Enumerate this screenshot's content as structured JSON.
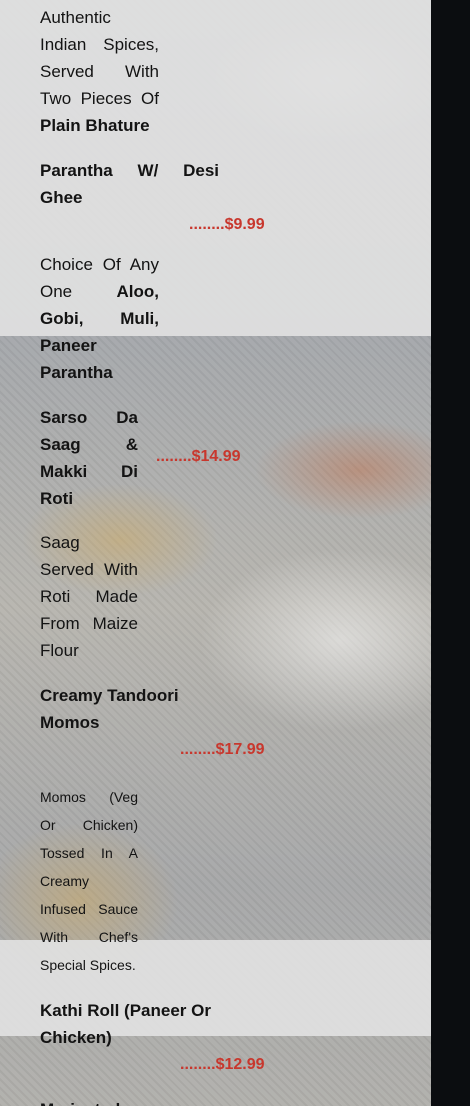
{
  "items": [
    {
      "description_prefix": "Authentic Indian Spices, Served With Two Pieces Of",
      "description_bold": "Plain Bhature"
    },
    {
      "name": "Parantha W/ Desi Ghee",
      "price": "........$9.99",
      "description_prefix": "Choice Of Any One",
      "description_bold": "Aloo, Gobi, Muli, Paneer Parantha"
    },
    {
      "name": "Sarso Da Saag & Makki Di Roti",
      "price": "........$14.99",
      "description": "Saag Served With Roti Made From Maize Flour"
    },
    {
      "name": "Creamy Tandoori Momos",
      "price": "........$17.99",
      "description": "Momos (Veg Or Chicken) Tossed In A Creamy Infused Sauce With Chef's Special Spices."
    },
    {
      "name": "Kathi Roll (Paneer Or Chicken)",
      "price": "........$12.99"
    },
    {
      "name_partial": "Marinated"
    }
  ],
  "colors": {
    "price": "#c8372d",
    "text": "#131313",
    "side_panel": "#0b0d10"
  }
}
